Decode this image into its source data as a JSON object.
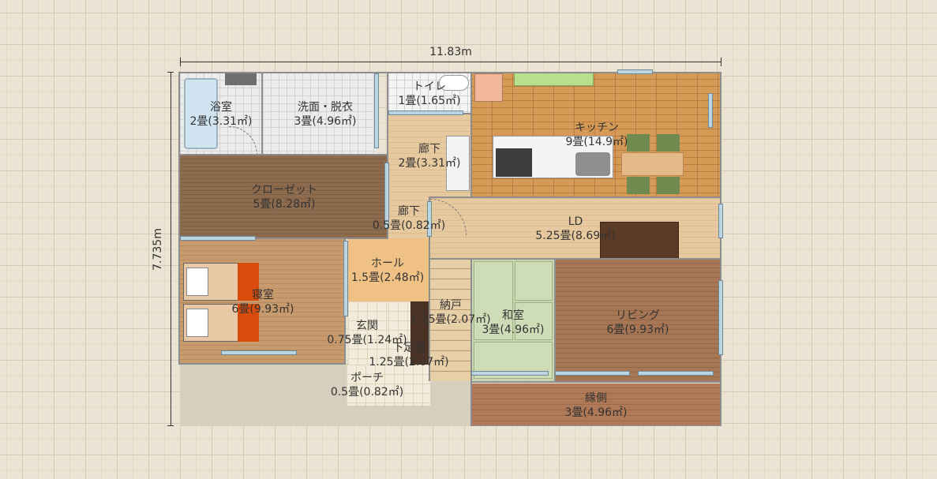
{
  "dimensions": {
    "width_label": "11.83m",
    "height_label": "7.735m"
  },
  "rooms": {
    "bath": {
      "name": "浴室",
      "size": "2畳(3.31㎡)"
    },
    "washroom": {
      "name": "洗面・脱衣",
      "size": "3畳(4.96㎡)"
    },
    "toilet": {
      "name": "トイレ",
      "size": "1畳(1.65㎡)"
    },
    "kitchen": {
      "name": "キッチン",
      "size": "9畳(14.9㎡)"
    },
    "hall_corridor": {
      "name": "廊下",
      "size": "2畳(3.31㎡)"
    },
    "closet": {
      "name": "クローゼット",
      "size": "5畳(8.28㎡)"
    },
    "corridor_small": {
      "name": "廊下",
      "size": "0.5畳(0.82㎡)"
    },
    "ld": {
      "name": "LD",
      "size": "5.25畳(8.69㎡)"
    },
    "hall": {
      "name": "ホール",
      "size": "1.5畳(2.48㎡)"
    },
    "bedroom": {
      "name": "寝室",
      "size": "6畳(9.93㎡)"
    },
    "storage": {
      "name": "納戸",
      "size": "1.25畳(2.07㎡)"
    },
    "washitsu": {
      "name": "和室",
      "size": "3畳(4.96㎡)"
    },
    "living": {
      "name": "リビング",
      "size": "6畳(9.93㎡)"
    },
    "entrance": {
      "name": "玄関",
      "size": "0.75畳(1.24㎡)"
    },
    "shoebox": {
      "name": "下足室",
      "size": "1.25畳(2.07㎡)"
    },
    "porch": {
      "name": "ポーチ",
      "size": "0.5畳(0.82㎡)"
    },
    "engawa": {
      "name": "縁側",
      "size": "3畳(4.96㎡)"
    }
  },
  "colors": {
    "grid_bg": "#ebe3d3",
    "kitchen_floor": "#d59a55",
    "bed_cover": "#d94c0c",
    "tatami": "#cfdcb8",
    "window": "#bcd5e0"
  }
}
